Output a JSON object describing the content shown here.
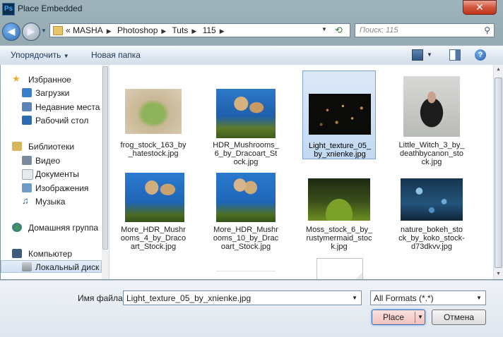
{
  "window": {
    "title": "Place Embedded",
    "app_icon": "Ps",
    "close_glyph": "✕"
  },
  "address": {
    "path": [
      "«",
      "MASHA",
      "Photoshop",
      "Tuts",
      "115"
    ],
    "search_placeholder": "Поиск: 115"
  },
  "toolbar": {
    "organize": "Упорядочить",
    "new_folder": "Новая папка",
    "help": "?"
  },
  "nav": {
    "items": [
      {
        "label": "Избранное",
        "icon": "star-icon"
      },
      {
        "label": "Загрузки",
        "icon": "downloads-folder-icon"
      },
      {
        "label": "Недавние места",
        "icon": "recent-places-icon"
      },
      {
        "label": "Рабочий стол",
        "icon": "desktop-icon"
      },
      {
        "label": "Библиотеки",
        "icon": "libraries-icon"
      },
      {
        "label": "Видео",
        "icon": "video-icon"
      },
      {
        "label": "Документы",
        "icon": "documents-icon"
      },
      {
        "label": "Изображения",
        "icon": "pictures-icon"
      },
      {
        "label": "Музыка",
        "icon": "music-icon"
      },
      {
        "label": "Домашняя группа",
        "icon": "homegroup-icon"
      },
      {
        "label": "Компьютер",
        "icon": "computer-icon"
      },
      {
        "label": "Локальный диск",
        "icon": "local-disk-icon"
      }
    ]
  },
  "files": [
    {
      "name": "frog_stock_163_by_hatestock.jpg",
      "lines": [
        "frog_stock_163_by",
        "_hatestock.jpg"
      ]
    },
    {
      "name": "HDR_Mushrooms_6_by_Dracoart_Stock.jpg",
      "lines": [
        "HDR_Mushrooms_",
        "6_by_Dracoart_St",
        "ock.jpg"
      ]
    },
    {
      "name": "Light_texture_05_by_xnienke.jpg",
      "lines": [
        "Light_texture_05_",
        "by_xnienke.jpg"
      ]
    },
    {
      "name": "Little_Witch_3_by_deathbycanon_stock.jpg",
      "lines": [
        "Little_Witch_3_by_",
        "deathbycanon_sto",
        "ck.jpg"
      ]
    },
    {
      "name": "More_HDR_Mushrooms_4_by_Dracoart_Stock.jpg",
      "lines": [
        "More_HDR_Mushr",
        "ooms_4_by_Draco",
        "art_Stock.jpg"
      ]
    },
    {
      "name": "More_HDR_Mushrooms_10_by_Dracoart_Stock.jpg",
      "lines": [
        "More_HDR_Mushr",
        "ooms_10_by_Drac",
        "oart_Stock.jpg"
      ]
    },
    {
      "name": "Moss_stock_6_by_rustymermaid_stock.jpg",
      "lines": [
        "Moss_stock_6_by_",
        "rustymermaid_stoc",
        "k.jpg"
      ]
    },
    {
      "name": "nature_bokeh_stock_by_koko_stock-d73dkvv.jpg",
      "lines": [
        "nature_bokeh_sto",
        "ck_by_koko_stock-",
        "d73dkvv.jpg"
      ]
    }
  ],
  "bottom": {
    "filename_label": "Имя файла:",
    "filename_value": "Light_texture_05_by_xnienke.jpg",
    "format_value": "All Formats (*.*)",
    "place_label": "Place",
    "cancel_label": "Отмена"
  },
  "colors": {
    "selection": "#c2d9f2",
    "accent": "#1e395b"
  }
}
